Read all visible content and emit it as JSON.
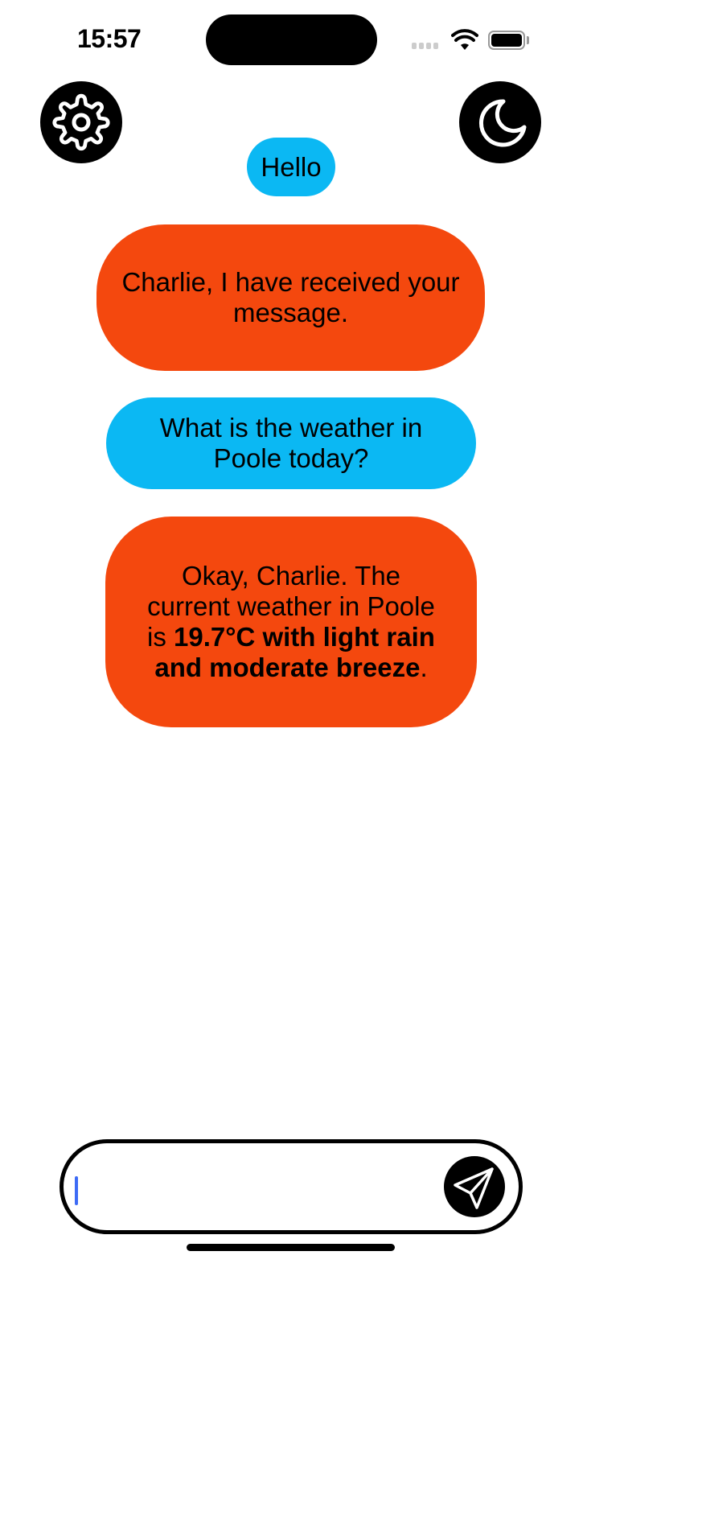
{
  "status_bar": {
    "time": "15:57"
  },
  "header": {
    "settings_icon": "gear-icon",
    "theme_icon": "moon-icon"
  },
  "messages": [
    {
      "role": "user",
      "text": "Hello"
    },
    {
      "role": "assistant",
      "text": "Charlie, I have received your message."
    },
    {
      "role": "user",
      "text": "What is the weather in Poole today?"
    },
    {
      "role": "assistant",
      "segments": {
        "a": "Okay, Charlie. The current weather in Poole is ",
        "b": "19.7°C with light rain and moderate breeze",
        "c": "."
      }
    }
  ],
  "composer": {
    "value": "",
    "send_icon": "paper-plane-icon"
  },
  "colors": {
    "user_bubble": "#0bb8f3",
    "assistant_bubble": "#f4480e",
    "cursor": "#3d6bf5"
  }
}
